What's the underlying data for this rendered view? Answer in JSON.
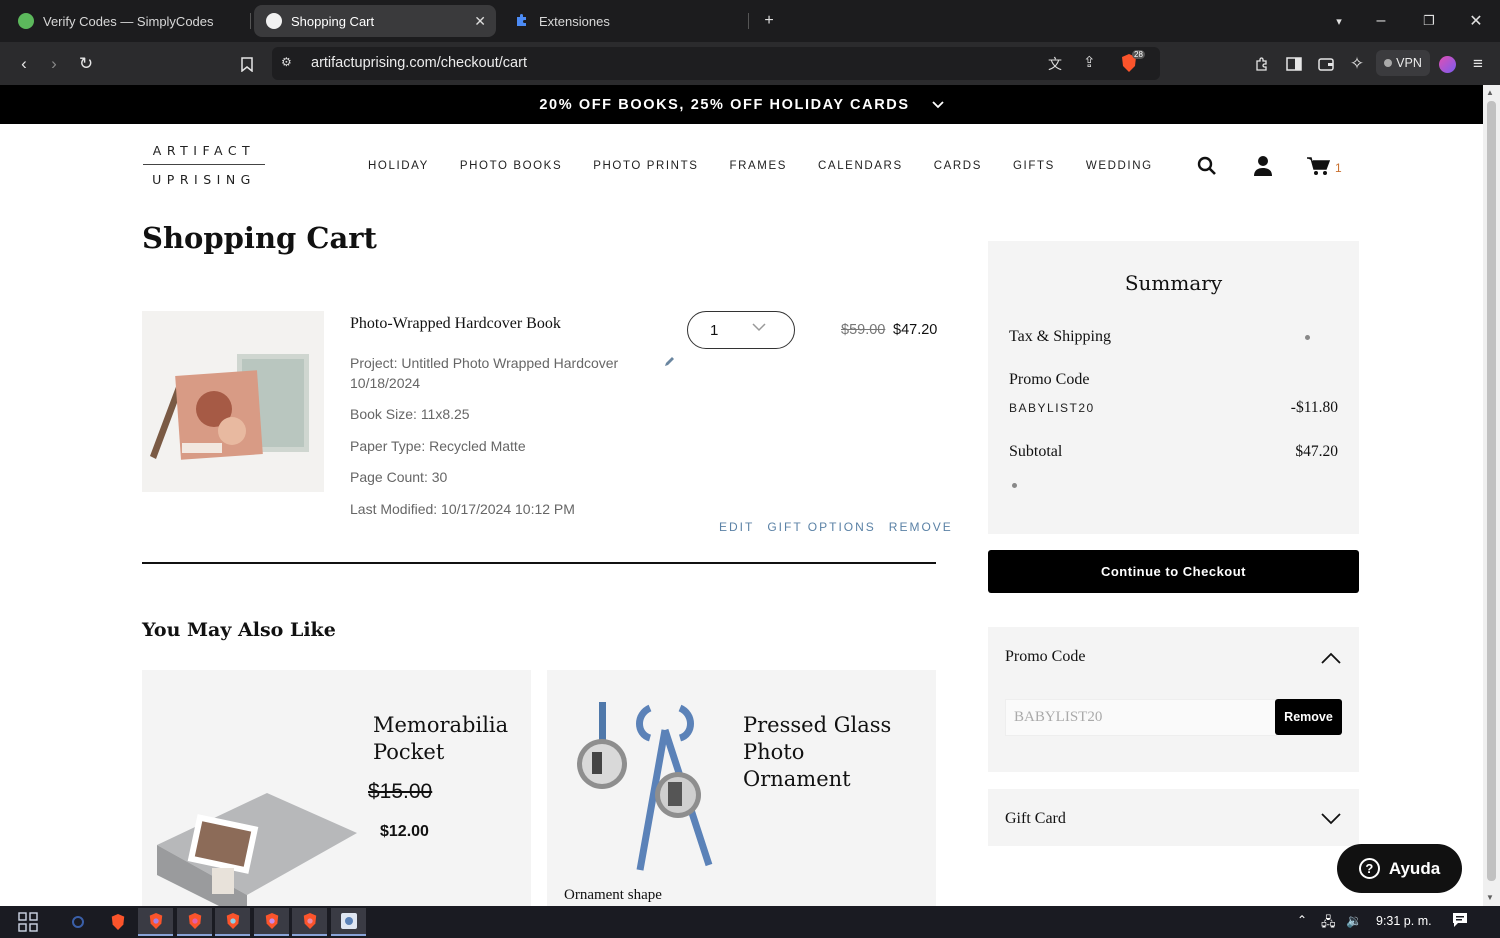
{
  "browser": {
    "tabs": [
      {
        "title": "Verify Codes — SimplyCodes"
      },
      {
        "title": "Shopping Cart"
      },
      {
        "title": "Extensiones"
      }
    ],
    "url": "artifactuprising.com/checkout/cart",
    "vpn_label": "VPN",
    "shield_badge": "28"
  },
  "site": {
    "banner": "20% OFF BOOKS, 25% OFF HOLIDAY CARDS",
    "logo_top": "ARTIFACT",
    "logo_bottom": "UPRISING",
    "nav": [
      "HOLIDAY",
      "PHOTO BOOKS",
      "PHOTO PRINTS",
      "FRAMES",
      "CALENDARS",
      "CARDS",
      "GIFTS",
      "WEDDING"
    ],
    "cart_count": "1"
  },
  "cart": {
    "title": "Shopping Cart",
    "item": {
      "name": "Photo-Wrapped Hardcover Book",
      "project_line1": "Project: Untitled Photo Wrapped Hardcover",
      "project_line2": "10/18/2024",
      "book_size": "Book Size: 11x8.25",
      "paper_type": "Paper Type: Recycled Matte",
      "page_count": "Page Count: 30",
      "last_modified": "Last Modified: 10/17/2024 10:12 PM",
      "quantity": "1",
      "price_old": "$59.00",
      "price_new": "$47.20",
      "actions": {
        "edit": "EDIT",
        "gift": "GIFT OPTIONS",
        "remove": "REMOVE"
      }
    }
  },
  "recommendations": {
    "title": "You May Also Like",
    "items": [
      {
        "name_line1": "Memorabilia",
        "name_line2": "Pocket",
        "price_old": "$15.00",
        "price_new": "$12.00"
      },
      {
        "name_line1": "Pressed Glass",
        "name_line2": "Photo",
        "name_line3": "Ornament",
        "note": "Ornament shape"
      }
    ]
  },
  "summary": {
    "title": "Summary",
    "tax_label": "Tax & Shipping",
    "promo_label": "Promo Code",
    "promo_code": "BABYLIST20",
    "promo_discount": "-$11.80",
    "subtotal_label": "Subtotal",
    "subtotal": "$47.20",
    "checkout_button": "Continue to Checkout"
  },
  "promo_panel": {
    "title": "Promo Code",
    "placeholder": "BABYLIST20",
    "remove_button": "Remove"
  },
  "gift_card_panel": {
    "title": "Gift Card"
  },
  "help": {
    "label": "Ayuda"
  },
  "taskbar": {
    "clock": "9:31 p. m."
  },
  "colors": {
    "accent_link": "#5b82a6",
    "cart_count": "#c9702f",
    "banner_bg": "#000000"
  }
}
